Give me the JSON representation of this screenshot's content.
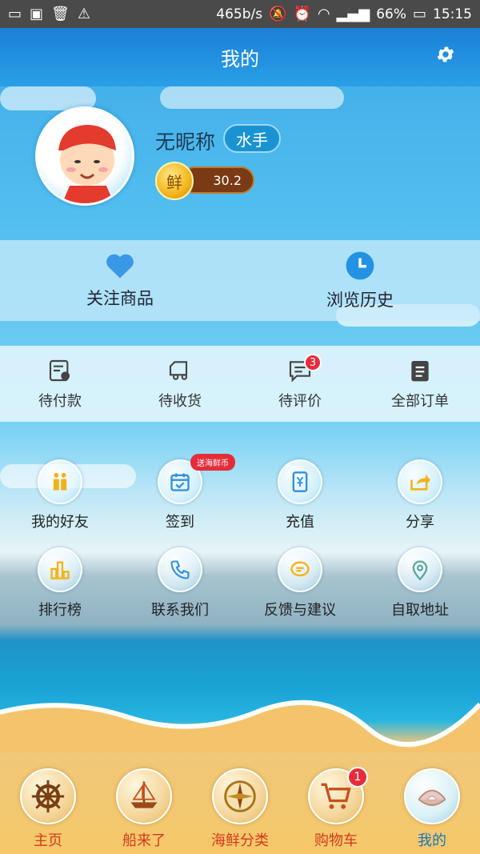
{
  "status_bar": {
    "speed": "465b/s",
    "battery": "66%",
    "time": "15:15"
  },
  "header": {
    "title": "我的"
  },
  "profile": {
    "nickname": "无昵称",
    "badge": "水手",
    "coin_char": "鲜",
    "coin_value": "30.2"
  },
  "quick_links": [
    {
      "label": "关注商品",
      "icon": "heart-icon"
    },
    {
      "label": "浏览历史",
      "icon": "clock-icon"
    }
  ],
  "orders": [
    {
      "label": "待付款",
      "icon": "payment-icon"
    },
    {
      "label": "待收货",
      "icon": "delivery-truck-icon"
    },
    {
      "label": "待评价",
      "icon": "comment-icon",
      "count": "3"
    },
    {
      "label": "全部订单",
      "icon": "clipboard-icon"
    }
  ],
  "services": [
    {
      "label": "我的好友",
      "icon": "friends-icon"
    },
    {
      "label": "签到",
      "icon": "calendar-check-icon",
      "tag": "送海鲜币"
    },
    {
      "label": "充值",
      "icon": "recharge-icon"
    },
    {
      "label": "分享",
      "icon": "share-icon"
    },
    {
      "label": "排行榜",
      "icon": "ranking-icon"
    },
    {
      "label": "联系我们",
      "icon": "phone-icon"
    },
    {
      "label": "反馈与建议",
      "icon": "feedback-icon"
    },
    {
      "label": "自取地址",
      "icon": "location-pin-icon"
    }
  ],
  "tabs": [
    {
      "label": "主页",
      "icon": "ship-wheel-icon"
    },
    {
      "label": "船来了",
      "icon": "sailboat-icon"
    },
    {
      "label": "海鲜分类",
      "icon": "compass-icon"
    },
    {
      "label": "购物车",
      "icon": "shopping-cart-icon",
      "count": "1"
    },
    {
      "label": "我的",
      "icon": "pearl-shell-icon",
      "active": true
    }
  ],
  "colors": {
    "header": "#1b7fd6",
    "badge": "#1a93d3",
    "accent_red": "#e52d3a",
    "tab_text": "#d23a1a",
    "tab_active": "#1a76b8"
  }
}
